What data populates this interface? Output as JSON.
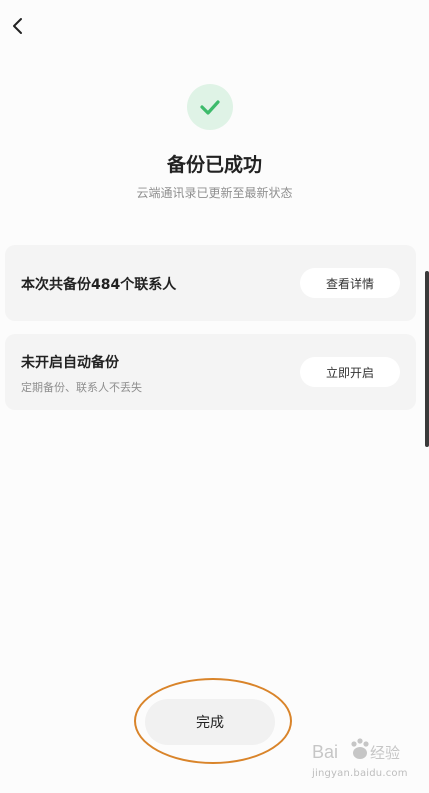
{
  "header": {
    "back_icon": "chevron-left-icon"
  },
  "status": {
    "icon": "check-icon",
    "accent": "#3dbb6b",
    "title": "备份已成功",
    "subtitle": "云端通讯录已更新至最新状态"
  },
  "cards": [
    {
      "title": "本次共备份484个联系人",
      "button": "查看详情"
    },
    {
      "title": "未开启自动备份",
      "desc": "定期备份、联系人不丢失",
      "button": "立即开启"
    }
  ],
  "footer": {
    "done_label": "完成",
    "annotation_color": "#d9842a"
  },
  "watermark": {
    "brand": "Baidu 经验",
    "url": "jingyan.baidu.com"
  }
}
